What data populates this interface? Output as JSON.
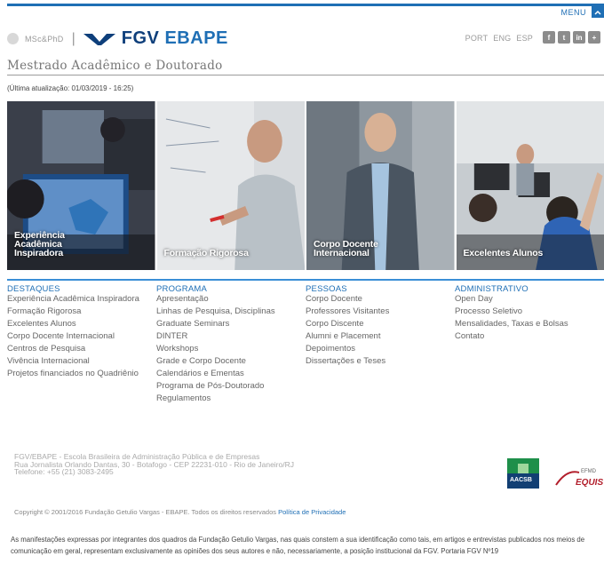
{
  "top": {
    "menu_label": "MENU",
    "menu_icon": "chevron-up-icon"
  },
  "header": {
    "program_label": "MSc&PhD",
    "separator": "|",
    "logo_fgv": "FGV",
    "logo_ebape": "EBAPE",
    "languages": [
      "PORT",
      "ENG",
      "ESP"
    ],
    "socials": [
      {
        "icon": "facebook-icon",
        "glyph": "f"
      },
      {
        "icon": "twitter-icon",
        "glyph": "t"
      },
      {
        "icon": "linkedin-icon",
        "glyph": "in"
      },
      {
        "icon": "share-icon",
        "glyph": "+"
      }
    ]
  },
  "page": {
    "title": "Mestrado Acadêmico e Doutorado",
    "updated": "(Última atualização: 01/03/2019 - 16:25)"
  },
  "gallery": [
    {
      "caption": "Experiência\nAcadêmica\nInspiradora"
    },
    {
      "caption": "Formação Rigorosa"
    },
    {
      "caption": "Corpo Docente\nInternacional"
    },
    {
      "caption": "Excelentes Alunos"
    }
  ],
  "columns": [
    {
      "heading": "DESTAQUES",
      "items": [
        "Experiência Acadêmica Inspiradora",
        "Formação Rigorosa",
        "Excelentes Alunos",
        "Corpo Docente Internacional",
        "Centros de Pesquisa",
        "Vivência Internacional",
        "Projetos financiados no Quadriênio"
      ]
    },
    {
      "heading": "PROGRAMA",
      "items": [
        "Apresentação",
        "Linhas de Pesquisa, Disciplinas",
        "Graduate Seminars",
        "DINTER",
        "Workshops",
        "Grade e Corpo Docente",
        "Calendários e Ementas",
        "Programa de Pós-Doutorado",
        "Regulamentos"
      ]
    },
    {
      "heading": "PESSOAS",
      "items": [
        "Corpo Docente",
        "Professores Visitantes",
        "Corpo Discente",
        "Alumni e Placement",
        "Depoimentos",
        "Dissertações e Teses"
      ]
    },
    {
      "heading": "ADMINISTRATIVO",
      "items": [
        "Open Day",
        "Processo Seletivo",
        "Mensalidades, Taxas e Bolsas",
        "Contato"
      ]
    }
  ],
  "footer": {
    "address_lines": [
      "FGV/EBAPE - Escola Brasileira de Administração Pública e de Empresas",
      "Rua Jornalista Orlando Dantas, 30 - Botafogo - CEP 22231-010 - Rio de Janeiro/RJ",
      "Telefone: +55 (21) 3083-2495"
    ],
    "aacsb_label": "AACSB",
    "efmd_label": "EFMD",
    "equis_label": "EQUIS",
    "copyright": "Copyright © 2001/2016 Fundação Getulio Vargas - EBAPE. Todos os direitos reservados",
    "privacy_link": "Política de Privacidade",
    "disclaimer": "As manifestações expressas por integrantes dos quadros da Fundação Getulio Vargas, nas quais constem a sua identificação como tais, em artigos e entrevistas publicados nos meios de comunicação em geral, representam exclusivamente as opiniões dos seus autores e não, necessariamente, a posição institucional da FGV. Portaria FGV Nº19"
  }
}
